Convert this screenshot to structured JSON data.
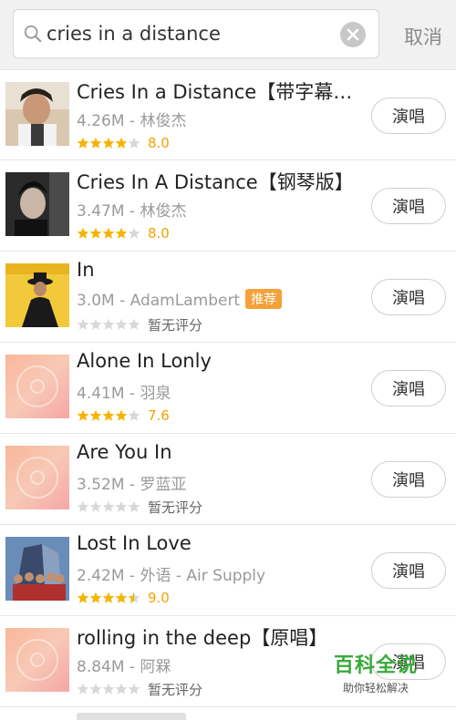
{
  "search": {
    "query": "cries in a distance",
    "cancel_label": "取消"
  },
  "songs": [
    {
      "title": "Cries In a Distance【带字幕高...",
      "meta": "4.26M - 林俊杰",
      "badge": "",
      "rating": 4,
      "score": "8.0",
      "no_score": "",
      "cover": "photo-a",
      "sing": "演唱"
    },
    {
      "title": "Cries In A Distance【钢琴版】",
      "meta": "3.47M - 林俊杰",
      "badge": "",
      "rating": 4,
      "score": "8.0",
      "no_score": "",
      "cover": "photo-b",
      "sing": "演唱"
    },
    {
      "title": "In",
      "meta": "3.0M - AdamLambert",
      "badge": "推荐",
      "rating": 0,
      "score": "",
      "no_score": "暂无评分",
      "cover": "photo-c",
      "sing": "演唱"
    },
    {
      "title": "Alone In Lonly",
      "meta": "4.41M - 羽泉",
      "badge": "",
      "rating": 4,
      "score": "7.6",
      "no_score": "",
      "cover": "placeholder",
      "sing": "演唱"
    },
    {
      "title": "Are You In",
      "meta": "3.52M - 罗蓝亚",
      "badge": "",
      "rating": 0,
      "score": "",
      "no_score": "暂无评分",
      "cover": "placeholder",
      "sing": "演唱"
    },
    {
      "title": "Lost In Love",
      "meta": "2.42M - 外语 - Air Supply",
      "badge": "",
      "rating": 4.5,
      "score": "9.0",
      "no_score": "",
      "cover": "photo-d",
      "sing": "演唱"
    },
    {
      "title": "rolling in the deep【原唱】",
      "meta": "8.84M - 阿槑",
      "badge": "",
      "rating": 0,
      "score": "",
      "no_score": "暂无评分",
      "cover": "placeholder",
      "sing": "演唱"
    }
  ],
  "watermark": {
    "title": "百科全说",
    "subtitle": "助你轻松解决"
  },
  "colors": {
    "star_filled": "#f5b400",
    "star_empty": "#d8d8d8",
    "score": "#f0a300",
    "badge": "#f5a13a",
    "watermark": "#3aaa3a"
  }
}
